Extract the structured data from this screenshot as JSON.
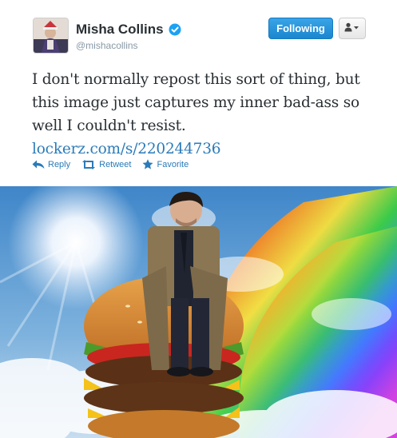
{
  "user": {
    "display_name": "Misha Collins",
    "handle": "@mishacollins",
    "verified": true
  },
  "follow_button": {
    "label": "Following"
  },
  "user_menu": {
    "icon": "user-dropdown-icon"
  },
  "tweet": {
    "text": "I don't normally repost this sort of thing, but this image just captures my inner bad-ass so well I couldn't resist.",
    "link": "lockerz.com/s/220244736"
  },
  "actions": [
    {
      "label": "Reply",
      "icon": "reply-icon"
    },
    {
      "label": "Retweet",
      "icon": "retweet-icon"
    },
    {
      "label": "Favorite",
      "icon": "star-icon"
    }
  ],
  "colors": {
    "link": "#2b7bb9",
    "follow_button": "#1b86cf",
    "verified_badge": "#1da1f2",
    "text": "#292f33",
    "handle": "#8899a6"
  }
}
